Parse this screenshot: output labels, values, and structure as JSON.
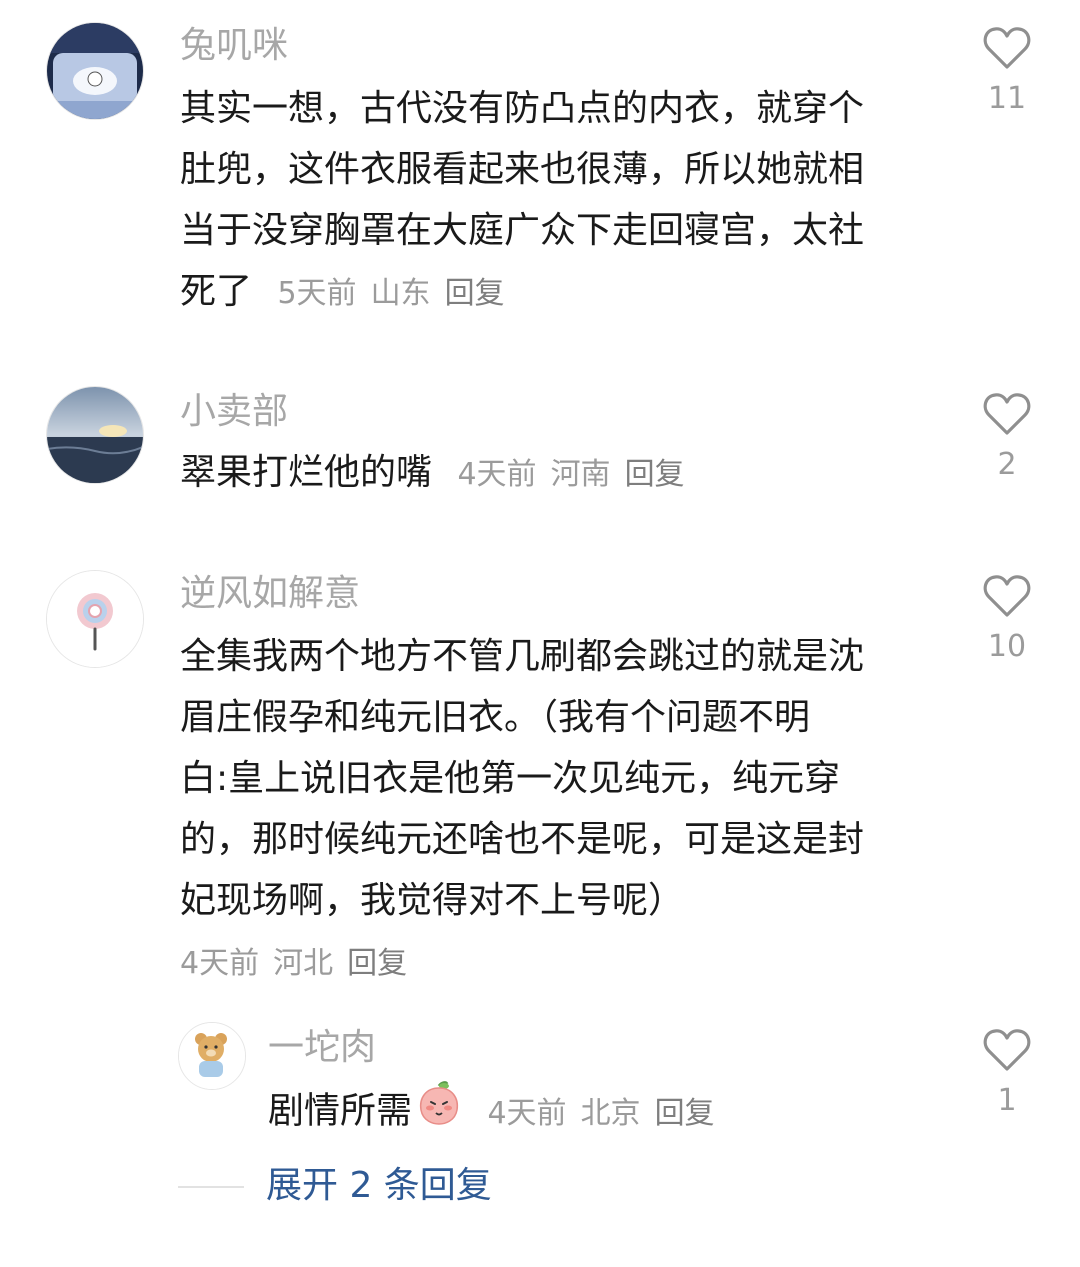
{
  "comments": [
    {
      "username": "兔叽咪",
      "content_lines": [
        "其实一想，古代没有防凸点的内衣，就穿个",
        "肚兜，这件衣服看起来也很薄，所以她就相",
        "当于没穿胸罩在大庭广众下走回寝宫，太社"
      ],
      "last_line": "死了",
      "time": "5天前",
      "location": "山东",
      "reply": "回复",
      "likes": "11"
    },
    {
      "username": "小卖部",
      "last_line": "翠果打烂他的嘴",
      "time": "4天前",
      "location": "河南",
      "reply": "回复",
      "likes": "2"
    },
    {
      "username": "逆风如解意",
      "content_lines": [
        "全集我两个地方不管几刷都会跳过的就是沈",
        "眉庄假孕和纯元旧衣。（我有个问题不明",
        "白:皇上说旧衣是他第一次见纯元，纯元穿",
        "的，那时候纯元还啥也不是呢，可是这是封",
        "妃现场啊，我觉得对不上号呢）"
      ],
      "time": "4天前",
      "location": "河北",
      "reply": "回复",
      "likes": "10"
    }
  ],
  "sub_reply": {
    "username": "一坨肉",
    "content": "剧情所需",
    "emoji_icon": "peach-shy-emoji",
    "time": "4天前",
    "location": "北京",
    "reply": "回复",
    "likes": "1"
  },
  "expand_replies": "展开 2 条回复",
  "colors": {
    "username": "#a7a7a7",
    "meta": "#9b9b9b",
    "expand_link": "#2f5a94"
  }
}
